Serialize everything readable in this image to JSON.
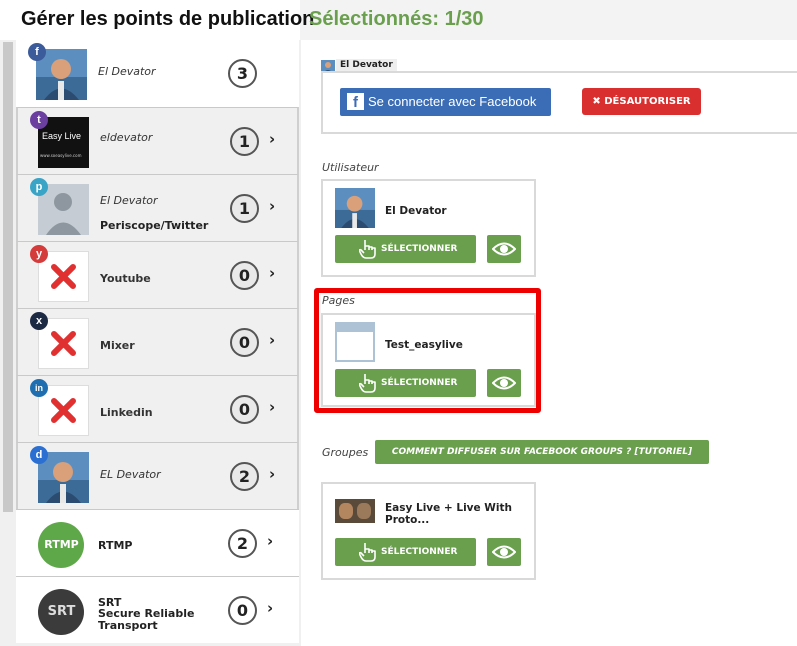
{
  "header": {
    "title": "Gérer les points de publication",
    "selected": "Sélectionnés: 1/30"
  },
  "sidebar": {
    "items": [
      {
        "platform": "facebook",
        "badge_icon": "facebook-icon",
        "badge_color": "#3b5b9a",
        "badge_text": "f",
        "name": "El Devator",
        "subname": "",
        "count": "3",
        "has_chevron": false
      },
      {
        "platform": "twitch",
        "badge_icon": "twitch-icon",
        "badge_color": "#6b3fa0",
        "badge_text": "t",
        "name": "eldevator",
        "subname": "",
        "count": "1",
        "has_chevron": true
      },
      {
        "platform": "periscope",
        "badge_icon": "periscope-icon",
        "badge_color": "#3aa4c6",
        "badge_text": "p",
        "name": "El Devator",
        "subname": "Periscope/Twitter",
        "count": "1",
        "has_chevron": true
      },
      {
        "platform": "youtube",
        "badge_icon": "youtube-icon",
        "badge_color": "#d43b3b",
        "badge_text": "y",
        "name": "Youtube",
        "subname": "",
        "count": "0",
        "has_chevron": true
      },
      {
        "platform": "mixer",
        "badge_icon": "mixer-icon",
        "badge_color": "#1d2a44",
        "badge_text": "x",
        "name": "Mixer",
        "subname": "",
        "count": "0",
        "has_chevron": true
      },
      {
        "platform": "linkedin",
        "badge_icon": "linkedin-icon",
        "badge_color": "#1f6fb0",
        "badge_text": "in",
        "name": "Linkedin",
        "subname": "",
        "count": "0",
        "has_chevron": true
      },
      {
        "platform": "dailymotion",
        "badge_icon": "dailymotion-icon",
        "badge_color": "#2a6fd1",
        "badge_text": "d",
        "name": "EL Devator",
        "subname": "",
        "count": "2",
        "has_chevron": true
      },
      {
        "platform": "rtmp",
        "badge_icon": "",
        "badge_color": "#6ab04c",
        "badge_text": "",
        "logo_text": "RTMP",
        "name": "RTMP",
        "subname": "",
        "count": "2",
        "has_chevron": true
      },
      {
        "platform": "srt",
        "badge_icon": "",
        "badge_color": "#3a3a3a",
        "badge_text": "",
        "logo_text": "SRT",
        "name": "SRT",
        "subname": "Secure Reliable Transport",
        "count": "0",
        "has_chevron": true
      }
    ],
    "thumb_texts": {
      "twitch_logo": "Easy Live",
      "twitch_url": "www.soeasylive.com"
    }
  },
  "account": {
    "label": "El Devator"
  },
  "facebook": {
    "connect_label": "Se connecter avec Facebook",
    "deauth_label": "DÉSAUTORISER"
  },
  "sections": {
    "user_label": "Utilisateur",
    "user_name": "El Devator",
    "pages_label": "Pages",
    "page_name": "Test_easylive",
    "groups_label": "Groupes",
    "groups_tutorial": "COMMENT DIFFUSER SUR FACEBOOK GROUPS ? [TUTORIEL]",
    "group_name": "Easy Live + Live With Proto..."
  },
  "buttons": {
    "select_label": "SÉLECTIONNER"
  },
  "colors": {
    "accent_green": "#6a9f4e",
    "highlight_red": "#ef0000",
    "facebook_blue": "#3b6db6",
    "deauth_red": "#d9302f"
  }
}
